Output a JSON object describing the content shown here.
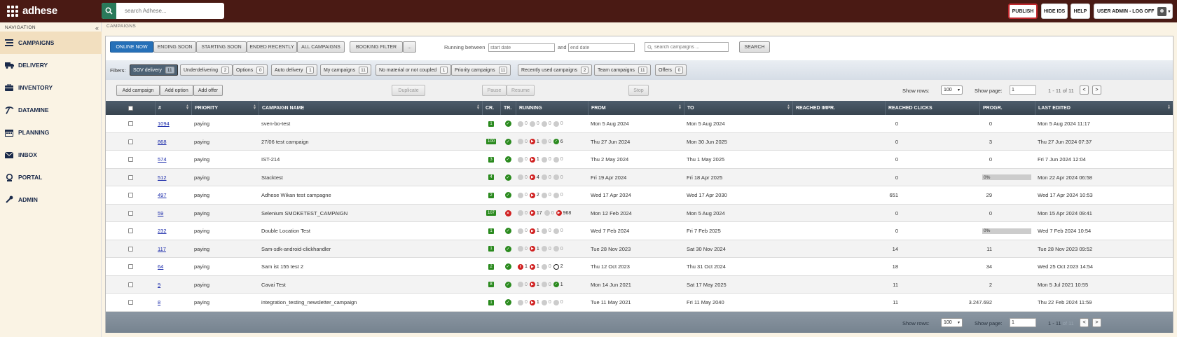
{
  "app": {
    "logo_text": "adhese",
    "search_placeholder": "search Adhese...",
    "buttons": {
      "publish": "PUBLISH",
      "hide_ids": "HIDE IDS",
      "help": "HELP",
      "user": "USER ADMIN - LOG OFF"
    }
  },
  "sidebar": {
    "title": "NAVIGATION",
    "items": [
      {
        "label": "CAMPAIGNS",
        "icon": "campaigns-icon",
        "active": true
      },
      {
        "label": "DELIVERY",
        "icon": "truck-icon"
      },
      {
        "label": "INVENTORY",
        "icon": "briefcase-icon"
      },
      {
        "label": "DATAMINE",
        "icon": "pickaxe-icon"
      },
      {
        "label": "PLANNING",
        "icon": "calendar-icon"
      },
      {
        "label": "INBOX",
        "icon": "envelope-icon"
      },
      {
        "label": "PORTAL",
        "icon": "portal-icon"
      },
      {
        "label": "ADMIN",
        "icon": "wrench-icon"
      }
    ]
  },
  "breadcrumb": "CAMPAIGNS",
  "tabs": [
    "ONLINE NOW",
    "ENDING SOON",
    "STARTING SOON",
    "ENDED RECENTLY",
    "ALL CAMPAIGNS"
  ],
  "booking_filter": "BOOKING FILTER",
  "booking_more": "...",
  "running_between": "Running between",
  "and_label": "and",
  "start_placeholder": "start date",
  "end_placeholder": "end date",
  "search_campaigns_placeholder": "search campaigns ...",
  "search_btn": "SEARCH",
  "filters_label": "Filters:",
  "filters": [
    {
      "label": "SOV delivery",
      "count": "11",
      "active": true
    },
    {
      "label": "Underdelivering",
      "count": "2"
    },
    {
      "label": "Options",
      "count": "0"
    },
    {
      "label": "Auto delivery",
      "count": "1"
    },
    {
      "label": "My campaigns",
      "count": "11"
    },
    {
      "label": "No material or not coupled",
      "count": "1"
    },
    {
      "label": "Priority campaigns",
      "count": "11"
    },
    {
      "label": "Recently used campaigns",
      "count": "2"
    },
    {
      "label": "Team campaigns",
      "count": "11"
    },
    {
      "label": "Offers",
      "count": "0"
    }
  ],
  "actions": {
    "add_campaign": "Add campaign",
    "add_option": "Add option",
    "add_offer": "Add offer",
    "duplicate": "Duplicate",
    "pause": "Pause",
    "resume": "Resume",
    "stop": "Stop"
  },
  "pager": {
    "show_rows_label": "Show rows:",
    "rows": "100",
    "show_page_label": "Show page:",
    "page": "1",
    "range": "1 - 11",
    "of_label": "of 11",
    "prev": "<",
    "next": ">"
  },
  "columns": [
    "#",
    "PRIORITY",
    "CAMPAIGN NAME",
    "CR.",
    "TR.",
    "RUNNING",
    "FROM",
    "TO",
    "REACHED IMPR.",
    "REACHED CLICKS",
    "PROGR.",
    "LAST EDITED"
  ],
  "rows": [
    {
      "id": "1094",
      "priority": "paying",
      "name": "sven-bo-test",
      "cr": "1",
      "tr": "ok",
      "run": [
        {
          "t": "g",
          "n": "0"
        },
        {
          "t": "g",
          "n": "0"
        },
        {
          "t": "g",
          "n": "0"
        },
        {
          "t": "g",
          "n": "0"
        }
      ],
      "from": "Mon 5 Aug 2024",
      "to": "Mon 5 Aug 2024",
      "impr": "0",
      "clicks": "0",
      "prog": "",
      "progv": 0,
      "edited": "Mon 5 Aug 2024 11:17"
    },
    {
      "id": "868",
      "priority": "paying",
      "name": "27/06 test campaign",
      "cr": "100",
      "tr": "ok",
      "run": [
        {
          "t": "g",
          "n": "0"
        },
        {
          "t": "r",
          "n": "1"
        },
        {
          "t": "g",
          "n": "0"
        },
        {
          "t": "gr",
          "n": "6"
        }
      ],
      "from": "Thu 27 Jun 2024",
      "to": "Mon 30 Jun 2025",
      "impr": "0",
      "clicks": "3",
      "prog": "",
      "progv": 0,
      "edited": "Thu 27 Jun 2024 07:37"
    },
    {
      "id": "574",
      "priority": "paying",
      "name": "IST-214",
      "cr": "3",
      "tr": "ok",
      "run": [
        {
          "t": "g",
          "n": "0"
        },
        {
          "t": "r",
          "n": "1"
        },
        {
          "t": "g",
          "n": "0"
        },
        {
          "t": "g",
          "n": "0"
        }
      ],
      "from": "Thu 2 May 2024",
      "to": "Thu 1 May 2025",
      "impr": "0",
      "clicks": "0",
      "prog": "",
      "progv": 0,
      "edited": "Fri 7 Jun 2024 12:04"
    },
    {
      "id": "512",
      "priority": "paying",
      "name": "Stacktest",
      "cr": "4",
      "tr": "ok",
      "run": [
        {
          "t": "g",
          "n": "0"
        },
        {
          "t": "r",
          "n": "4"
        },
        {
          "t": "g",
          "n": "0"
        },
        {
          "t": "g",
          "n": "0"
        }
      ],
      "from": "Fri 19 Apr 2024",
      "to": "Fri 18 Apr 2025",
      "impr": "0",
      "clicks": "0",
      "prog": "0%",
      "progv": 0,
      "edited": "Mon 22 Apr 2024 06:58"
    },
    {
      "id": "497",
      "priority": "paying",
      "name": "Adhese Wikan test campagne",
      "cr": "2",
      "tr": "ok",
      "run": [
        {
          "t": "g",
          "n": "0"
        },
        {
          "t": "r",
          "n": "2"
        },
        {
          "t": "g",
          "n": "0"
        },
        {
          "t": "g",
          "n": "0"
        }
      ],
      "from": "Wed 17 Apr 2024",
      "to": "Wed 17 Apr 2030",
      "impr": "651",
      "clicks": "29",
      "prog": "",
      "progv": 0,
      "edited": "Wed 17 Apr 2024 10:53"
    },
    {
      "id": "59",
      "priority": "paying",
      "name": "Selenium SMOKETEST_CAMPAIGN",
      "cr": "107",
      "tr": "bad",
      "run": [
        {
          "t": "g",
          "n": "0"
        },
        {
          "t": "r",
          "n": "17"
        },
        {
          "t": "g",
          "n": "0"
        },
        {
          "t": "r",
          "n": "968"
        }
      ],
      "from": "Mon 12 Feb 2024",
      "to": "Mon 5 Aug 2024",
      "impr": "0",
      "clicks": "0",
      "prog": "",
      "progv": 0,
      "edited": "Mon 15 Apr 2024 09:41"
    },
    {
      "id": "232",
      "priority": "paying",
      "name": "Double Location Test",
      "cr": "1",
      "tr": "ok",
      "run": [
        {
          "t": "g",
          "n": "0"
        },
        {
          "t": "r",
          "n": "1"
        },
        {
          "t": "g",
          "n": "0"
        },
        {
          "t": "g",
          "n": "0"
        }
      ],
      "from": "Wed 7 Feb 2024",
      "to": "Fri 7 Feb 2025",
      "impr": "0",
      "clicks": "0",
      "prog": "0%",
      "progv": 0,
      "edited": "Wed 7 Feb 2024 10:54"
    },
    {
      "id": "117",
      "priority": "paying",
      "name": "Sam-sdk-android-clickhandler",
      "cr": "1",
      "tr": "ok",
      "run": [
        {
          "t": "g",
          "n": "0"
        },
        {
          "t": "r",
          "n": "1"
        },
        {
          "t": "g",
          "n": "0"
        },
        {
          "t": "g",
          "n": "0"
        }
      ],
      "from": "Tue 28 Nov 2023",
      "to": "Sat 30 Nov 2024",
      "impr": "14",
      "clicks": "11",
      "prog": "",
      "progv": 0,
      "edited": "Tue 28 Nov 2023 09:52"
    },
    {
      "id": "64",
      "priority": "paying",
      "name": "Sam ist 155 test 2",
      "cr": "2",
      "tr": "ok",
      "run": [
        {
          "t": "r",
          "n": "1"
        },
        {
          "t": "r",
          "n": "1"
        },
        {
          "t": "g",
          "n": "0"
        },
        {
          "t": "o",
          "n": "2"
        }
      ],
      "from": "Thu 12 Oct 2023",
      "to": "Thu 31 Oct 2024",
      "impr": "18",
      "clicks": "34",
      "prog": "",
      "progv": 0,
      "edited": "Wed 25 Oct 2023 14:54"
    },
    {
      "id": "9",
      "priority": "paying",
      "name": "Cavai Test",
      "cr": "8",
      "tr": "ok",
      "run": [
        {
          "t": "g",
          "n": "0"
        },
        {
          "t": "r",
          "n": "1"
        },
        {
          "t": "g",
          "n": "0"
        },
        {
          "t": "gr",
          "n": "1"
        }
      ],
      "from": "Mon 14 Jun 2021",
      "to": "Sat 17 May 2025",
      "impr": "11",
      "clicks": "2",
      "prog": "",
      "progv": 0,
      "edited": "Mon 5 Jul 2021 10:55"
    },
    {
      "id": "8",
      "priority": "paying",
      "name": "integration_testing_newsletter_campaign",
      "cr": "1",
      "tr": "ok",
      "run": [
        {
          "t": "g",
          "n": "0"
        },
        {
          "t": "r",
          "n": "1"
        },
        {
          "t": "g",
          "n": "0"
        },
        {
          "t": "g",
          "n": "0"
        }
      ],
      "from": "Tue 11 May 2021",
      "to": "Fri 11 May 2040",
      "impr": "11",
      "clicks": "3.247.692",
      "prog": "",
      "progv": 0,
      "edited": "Thu 22 Feb 2024 11:59"
    }
  ]
}
